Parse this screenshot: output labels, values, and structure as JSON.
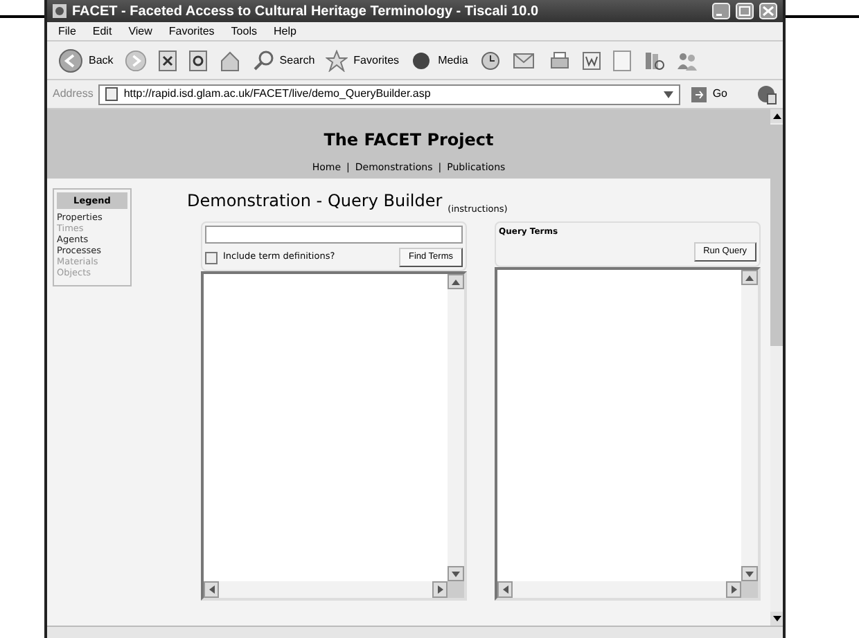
{
  "window": {
    "title": "FACET - Faceted Access to Cultural Heritage Terminology - Tiscali 10.0"
  },
  "menu": [
    "File",
    "Edit",
    "View",
    "Favorites",
    "Tools",
    "Help"
  ],
  "toolbar": {
    "back": "Back",
    "search": "Search",
    "favorites": "Favorites",
    "media": "Media"
  },
  "address": {
    "label": "Address",
    "url": "http://rapid.isd.glam.ac.uk/FACET/live/demo_QueryBuilder.asp",
    "go": "Go"
  },
  "site": {
    "title": "The FACET Project",
    "nav": [
      "Home",
      "Demonstrations",
      "Publications"
    ],
    "separator": "|"
  },
  "legend": {
    "title": "Legend",
    "items": [
      {
        "label": "Properties",
        "dimmed": false
      },
      {
        "label": "Times",
        "dimmed": true
      },
      {
        "label": "Agents",
        "dimmed": false
      },
      {
        "label": "Processes",
        "dimmed": false
      },
      {
        "label": "Materials",
        "dimmed": true
      },
      {
        "label": "Objects",
        "dimmed": true
      }
    ]
  },
  "heading": "Demonstration - Query Builder",
  "instructions": "(instructions)",
  "search_panel": {
    "checkbox": {
      "label": "Include term definitions?",
      "checked": false
    },
    "button": "Find Terms"
  },
  "query_panel": {
    "title": "Query Terms",
    "button": "Run Query"
  }
}
